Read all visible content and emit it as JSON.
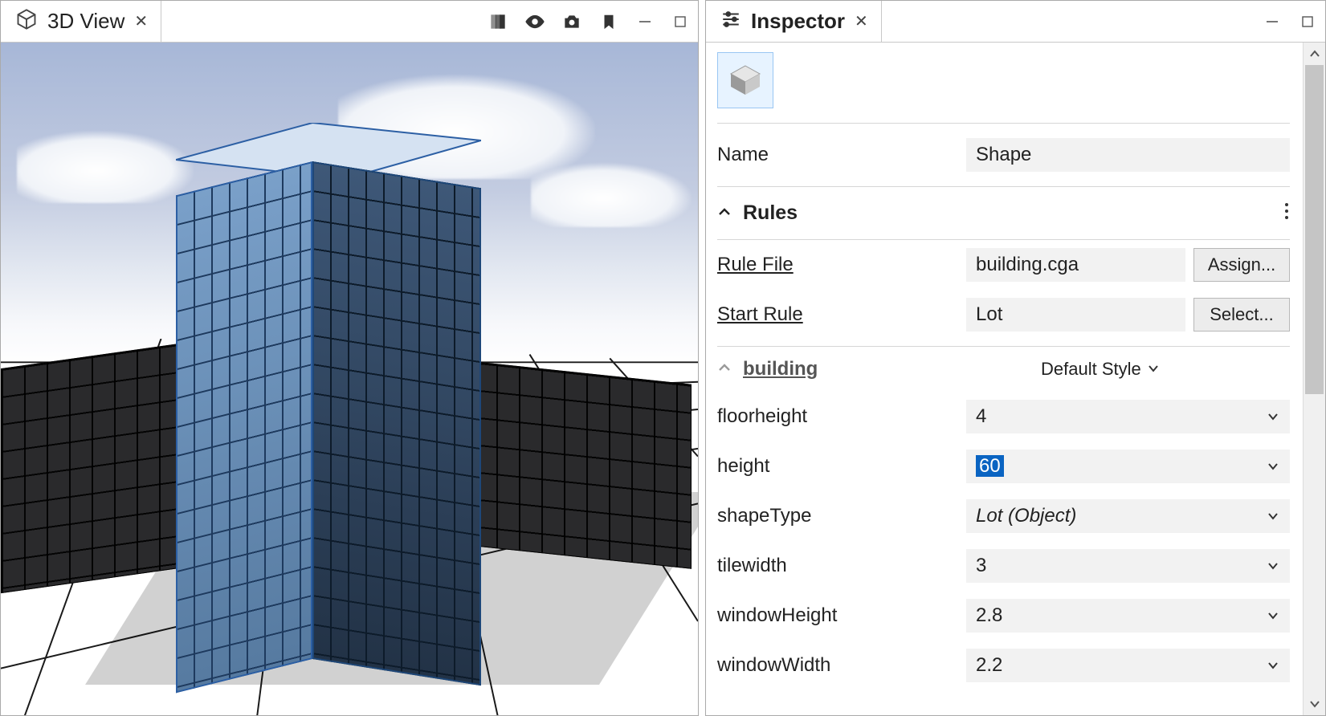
{
  "left_panel": {
    "title": "3D View"
  },
  "right_panel": {
    "title": "Inspector",
    "name_label": "Name",
    "name_value": "Shape",
    "rules_section": "Rules",
    "rule_file_label": "Rule File",
    "rule_file_value": "building.cga",
    "rule_file_btn": "Assign...",
    "start_rule_label": "Start Rule",
    "start_rule_value": "Lot",
    "start_rule_btn": "Select...",
    "building_section": "building",
    "style_value": "Default Style",
    "params": [
      {
        "label": "floorheight",
        "value": "4"
      },
      {
        "label": "height",
        "value": "60",
        "selected": true
      },
      {
        "label": "shapeType",
        "value": "Lot (Object)",
        "italic": true
      },
      {
        "label": "tilewidth",
        "value": "3"
      },
      {
        "label": "windowHeight",
        "value": "2.8"
      },
      {
        "label": "windowWidth",
        "value": "2.2"
      }
    ]
  }
}
